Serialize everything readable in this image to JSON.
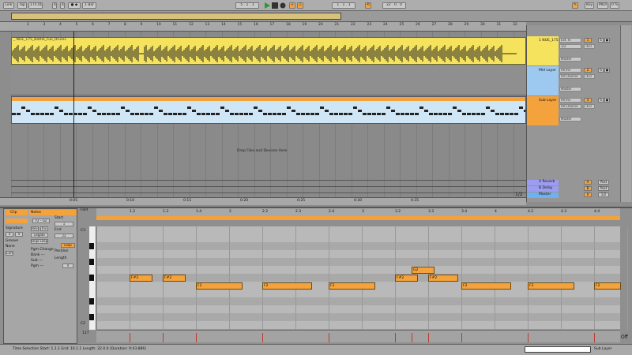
{
  "toolbar": {
    "link": "Link",
    "tap": "Tap",
    "tempo": "175.00",
    "sig_num": "4",
    "sig_den": "4",
    "quant": "1 Bar",
    "position": "5 . 1 . 1",
    "loop_start": "1 . 1 . 1",
    "loop_len": "22 . 0 . 0",
    "key": "Key",
    "midi": "MIDI",
    "cpu": "0 %"
  },
  "ruler": {
    "bars": [
      "2",
      "3",
      "4",
      "5",
      "6",
      "7",
      "8",
      "9",
      "10",
      "11",
      "12",
      "13",
      "14",
      "15",
      "16",
      "17",
      "18",
      "19",
      "20",
      "21",
      "22",
      "23",
      "24",
      "25",
      "26",
      "27",
      "28",
      "29",
      "30",
      "31",
      "32"
    ],
    "times": [
      "0:05",
      "0:10",
      "0:15",
      "0:20",
      "0:25",
      "0:30",
      "0:35"
    ]
  },
  "arrangement": {
    "drop_text": "Drop Files and Devices Here",
    "clip_name": "_ NUE_175_Battle_Full_Drums",
    "zoom": "1/2"
  },
  "tracks": [
    {
      "name": "1 NUE_175",
      "color": "#f5e25d",
      "input": "Ext. In",
      "sub": "1/2",
      "monitor": "Master",
      "num": "1",
      "vol": "-6.0"
    },
    {
      "name": "Mid Layer",
      "color": "#9dc9f0",
      "input": "All Ins",
      "sub": "All Channe",
      "monitor": "Master",
      "num": "2",
      "vol": "-6.0",
      "auto": "Auto",
      "off": "Off"
    },
    {
      "name": "Sub Layer",
      "color": "#f3a23c",
      "input": "All Ins",
      "sub": "All Channe",
      "monitor": "Master",
      "num": "3",
      "vol": "-6.0",
      "auto": "Auto",
      "off": "Off"
    }
  ],
  "returns": [
    {
      "name": "A Reverb",
      "color": "#9c9cf0",
      "num": "A",
      "post": "Post"
    },
    {
      "name": "B Delay",
      "color": "#9c9cf0",
      "num": "B",
      "post": "Post"
    },
    {
      "name": "Master",
      "color": "#6fb0ee",
      "num": "0",
      "out": "1/2"
    }
  ],
  "clip_panel": {
    "clip_tab": "Clip",
    "notes_tab": "Notes",
    "start": "Start",
    "end": "End",
    "loop": "Loop",
    "position": "Position",
    "length": "Length",
    "signature": "Signature",
    "sig_num": "4",
    "sig_den": "4",
    "groove": "Groove",
    "groove_val": "None",
    "commit": "Commit",
    "pgm": "Pgm Change",
    "bank": "Bank ---",
    "sub": "Sub ---",
    "pgm_val": "Pgm ---",
    "legato": "Legato",
    "dupl": "Dupl.Loop",
    "rev": "Rev",
    "inv": "Inv",
    "start_val": "1",
    "end_val": "22",
    "len_val": "4",
    "fold": "Fold"
  },
  "editor": {
    "c3": "C3",
    "c2": "C2",
    "ruler": [
      "1.2",
      "1.3",
      "1.4",
      "2",
      "2.2",
      "2.3",
      "2.4",
      "3",
      "3.2",
      "3.3",
      "3.4",
      "4",
      "4.2",
      "4.3",
      "4.4"
    ],
    "vel_label": "127",
    "off_label": "Off"
  },
  "notes": [
    {
      "label": "F#2",
      "pitch": "F#2",
      "start": 1.0,
      "dur": 0.35
    },
    {
      "label": "F#2",
      "pitch": "F#2",
      "start": 1.5,
      "dur": 0.35
    },
    {
      "label": "F2",
      "pitch": "F2",
      "start": 2.0,
      "dur": 0.7
    },
    {
      "label": "F2",
      "pitch": "F2",
      "start": 3.0,
      "dur": 0.75
    },
    {
      "label": "F2",
      "pitch": "F2",
      "start": 4.0,
      "dur": 0.7
    },
    {
      "label": "F#2",
      "pitch": "F#2",
      "start": 5.0,
      "dur": 0.35
    },
    {
      "label": "G2",
      "pitch": "G2",
      "start": 5.25,
      "dur": 0.35
    },
    {
      "label": "F#2",
      "pitch": "F#2",
      "start": 5.5,
      "dur": 0.45
    },
    {
      "label": "F2",
      "pitch": "F2",
      "start": 6.0,
      "dur": 0.75
    },
    {
      "label": "F2",
      "pitch": "F2",
      "start": 7.0,
      "dur": 0.7
    },
    {
      "label": "F2",
      "pitch": "F2",
      "start": 8.0,
      "dur": 0.4
    }
  ],
  "status": {
    "text": "Time Selection   Start: 1.1.1   End: 10.1.1   Length: 32.0.0 (Duration: 0:43.886)",
    "track": "Sub Layer"
  }
}
